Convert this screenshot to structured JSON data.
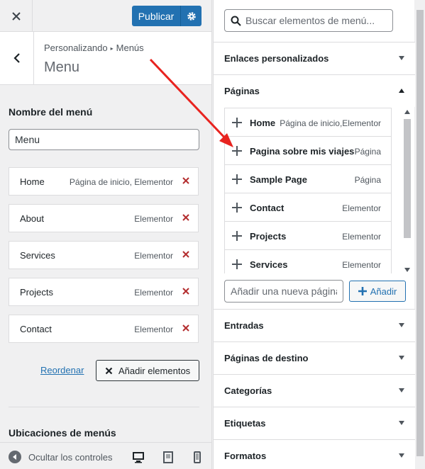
{
  "topbar": {
    "publish_label": "Publicar"
  },
  "header": {
    "breadcrumb_root": "Personalizando",
    "breadcrumb_current": "Menús",
    "title": "Menu"
  },
  "menu_name": {
    "label": "Nombre del menú",
    "value": "Menu"
  },
  "menu_items": [
    {
      "title": "Home",
      "type": "Página de inicio, Elementor"
    },
    {
      "title": "About",
      "type": "Elementor"
    },
    {
      "title": "Services",
      "type": "Elementor"
    },
    {
      "title": "Projects",
      "type": "Elementor"
    },
    {
      "title": "Contact",
      "type": "Elementor"
    }
  ],
  "actions": {
    "reorder": "Reordenar",
    "add_items": "Añadir elementos"
  },
  "locations": {
    "label": "Ubicaciones de menús"
  },
  "footer": {
    "collapse": "Ocultar los controles"
  },
  "search": {
    "placeholder": "Buscar elementos de menú..."
  },
  "accordion": {
    "custom_links": "Enlaces personalizados",
    "pages": "Páginas",
    "posts": "Entradas",
    "landing_pages": "Páginas de destino",
    "categories": "Categorías",
    "tags": "Etiquetas",
    "formats": "Formatos"
  },
  "pages": [
    {
      "title": "Home",
      "type": "Página de inicio,Elementor"
    },
    {
      "title": "Pagina sobre mis viajes",
      "type": "Página"
    },
    {
      "title": "Sample Page",
      "type": "Página"
    },
    {
      "title": "Contact",
      "type": "Elementor"
    },
    {
      "title": "Projects",
      "type": "Elementor"
    },
    {
      "title": "Services",
      "type": "Elementor"
    }
  ],
  "new_page": {
    "placeholder": "Añadir una nueva página",
    "button": "Añadir"
  },
  "colors": {
    "accent": "#2271b1",
    "delete": "#b32d2e",
    "annotation": "#e8231f"
  }
}
